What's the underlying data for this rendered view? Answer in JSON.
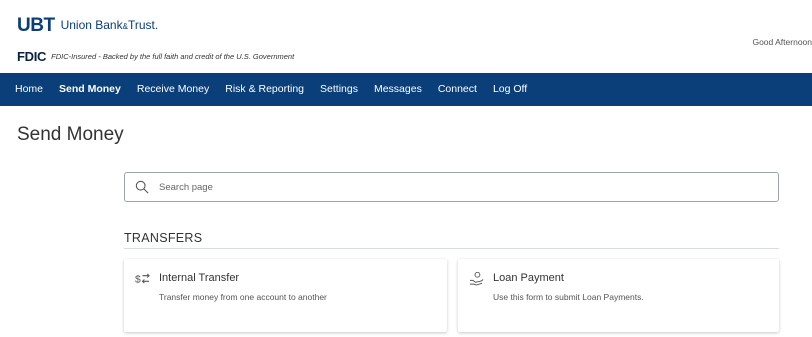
{
  "header": {
    "logo_mark": "UBT",
    "logo_name": "Union Bank",
    "logo_amp": "&",
    "logo_name2": "Trust.",
    "fdic_mark": "FDIC",
    "fdic_text": "FDIC-Insured - Backed by the full faith and credit of the U.S. Government",
    "greeting": "Good Afternoon"
  },
  "nav": {
    "items": [
      {
        "label": "Home"
      },
      {
        "label": "Send Money"
      },
      {
        "label": "Receive Money"
      },
      {
        "label": "Risk & Reporting"
      },
      {
        "label": "Settings"
      },
      {
        "label": "Messages"
      },
      {
        "label": "Connect"
      },
      {
        "label": "Log Off"
      }
    ],
    "active_index": 1
  },
  "main": {
    "title": "Send Money",
    "search": {
      "placeholder": "Search page",
      "value": ""
    },
    "section": "TRANSFERS",
    "cards": [
      {
        "title": "Internal Transfer",
        "description": "Transfer money from one account to another",
        "icon": "transfer-icon"
      },
      {
        "title": "Loan Payment",
        "description": "Use this form to submit Loan Payments.",
        "icon": "loan-payment-icon"
      }
    ]
  },
  "colors": {
    "brand": "#0b3f7a",
    "text": "#333333"
  }
}
